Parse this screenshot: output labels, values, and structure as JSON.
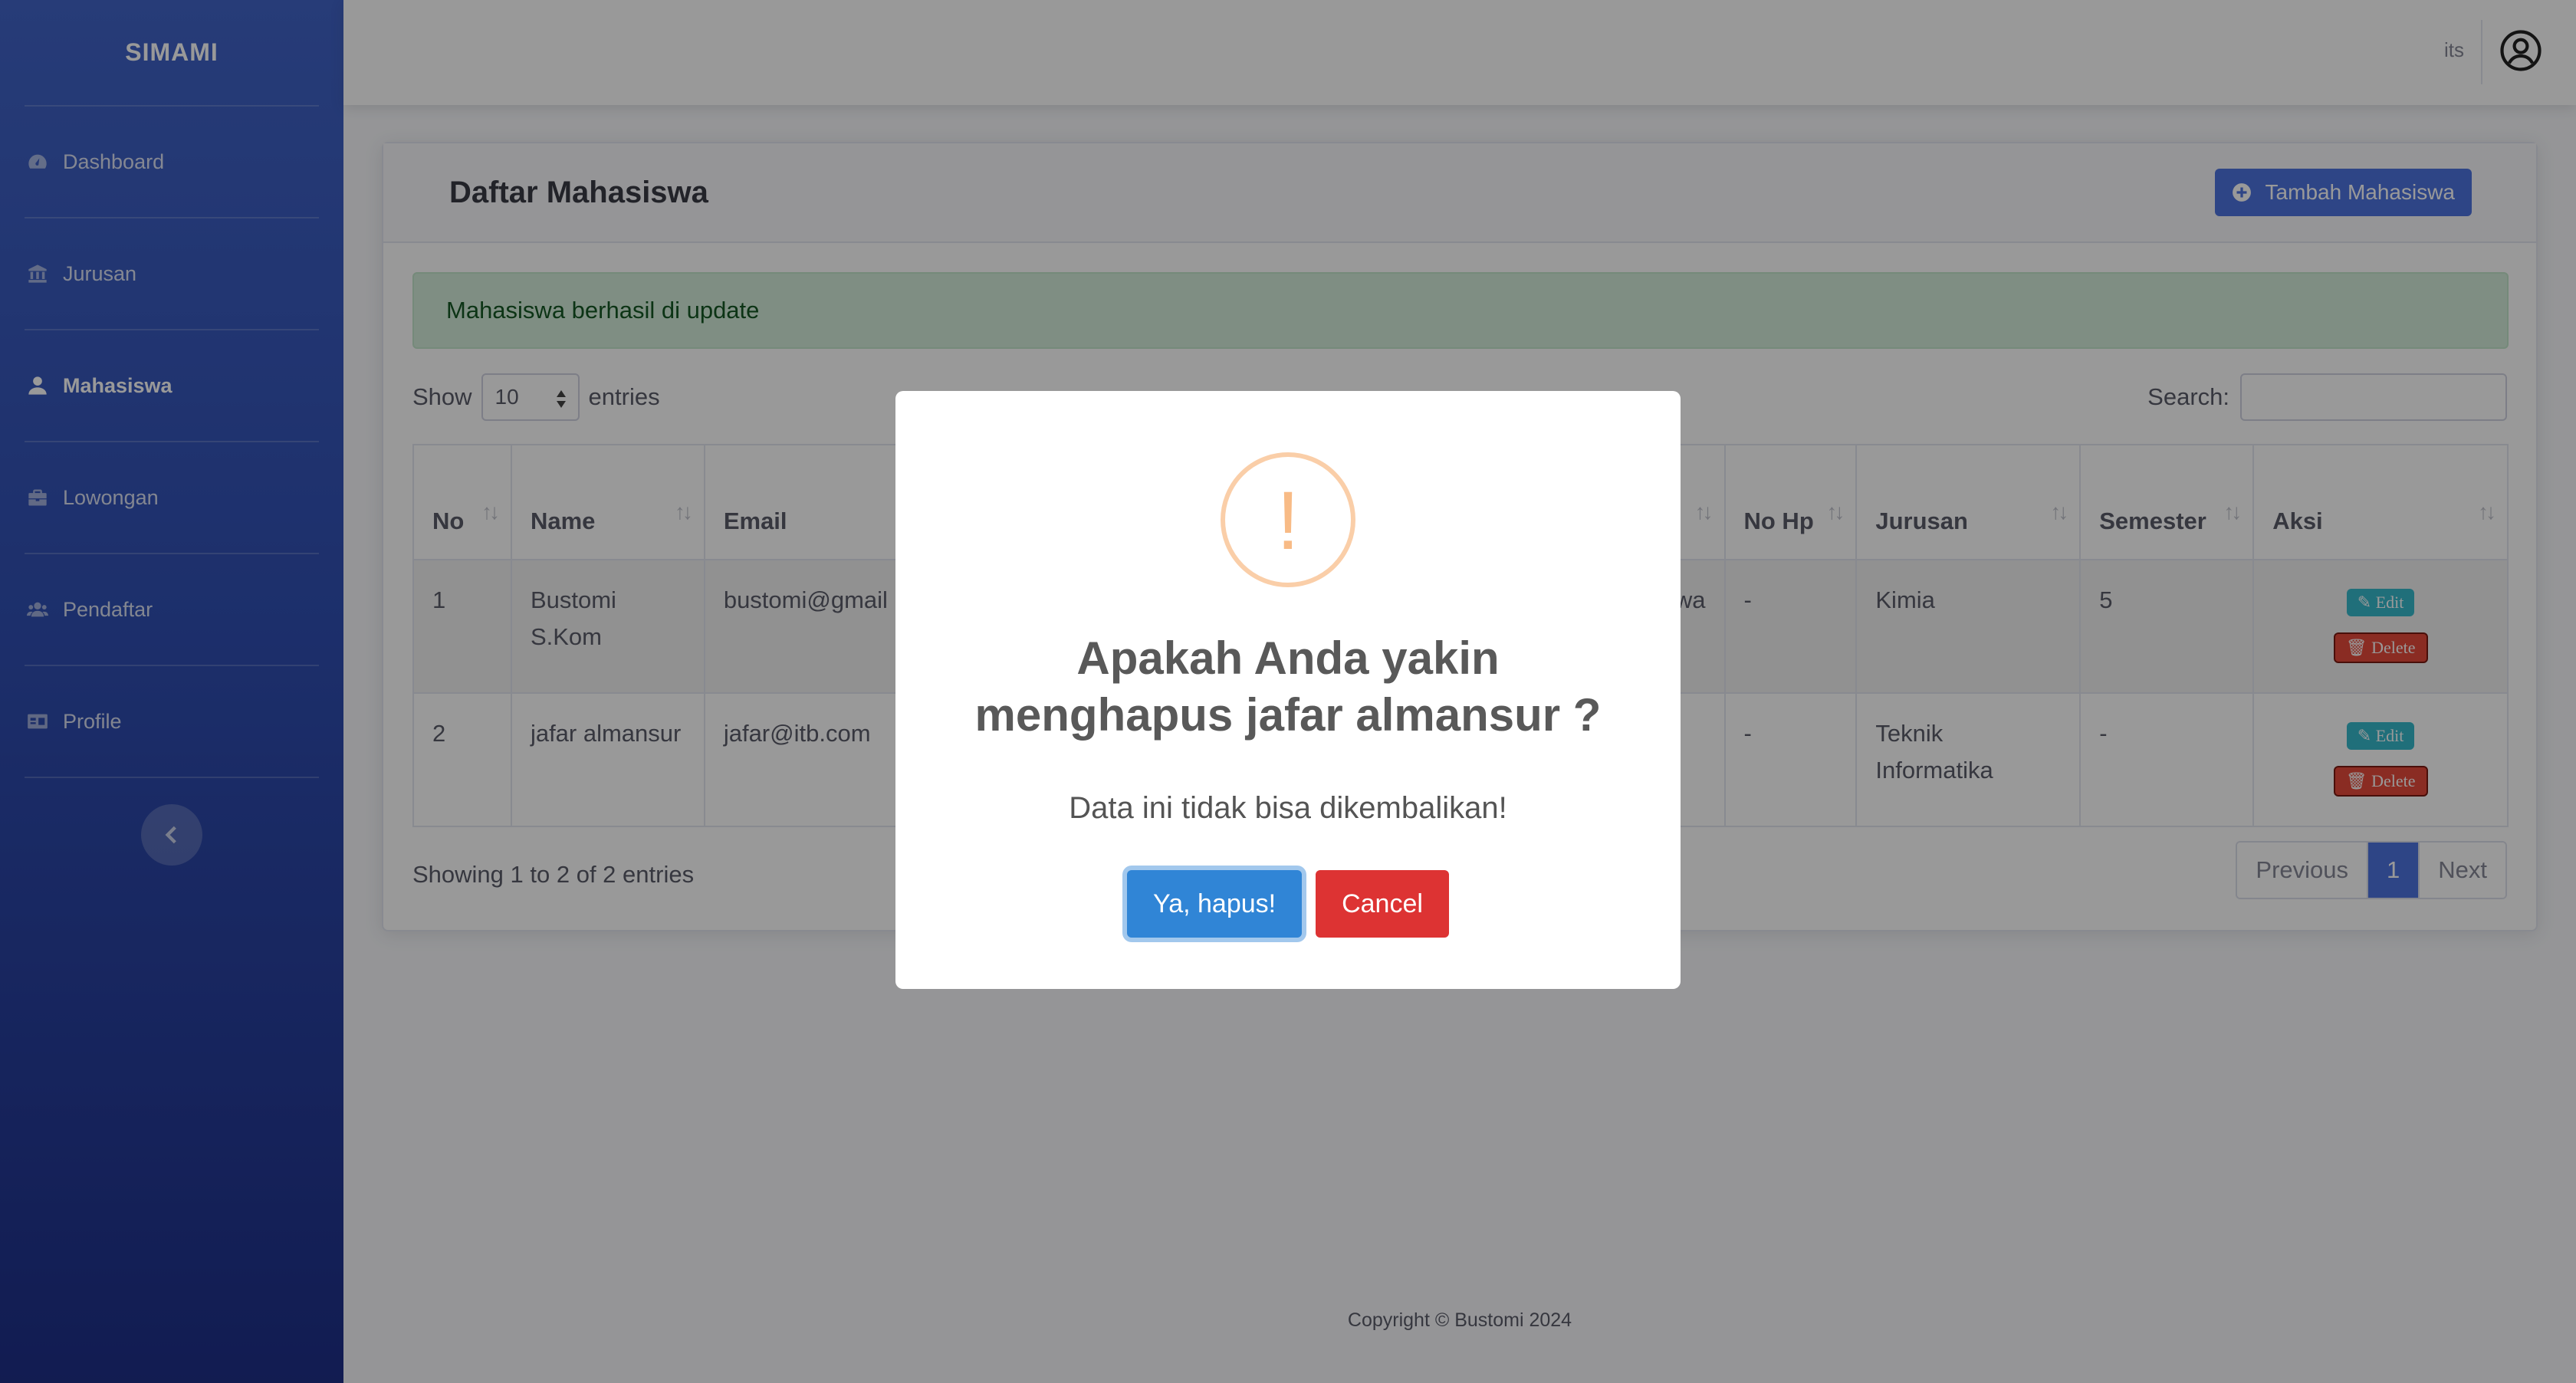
{
  "sidebar": {
    "brand": "SIMAMI",
    "items": [
      {
        "label": "Dashboard",
        "icon": "dashboard-icon"
      },
      {
        "label": "Jurusan",
        "icon": "university-icon"
      },
      {
        "label": "Mahasiswa",
        "icon": "user-icon",
        "active": true
      },
      {
        "label": "Lowongan",
        "icon": "briefcase-icon"
      },
      {
        "label": "Pendaftar",
        "icon": "users-icon"
      },
      {
        "label": "Profile",
        "icon": "id-card-icon"
      }
    ]
  },
  "topbar": {
    "user_name": "its"
  },
  "card": {
    "title": "Daftar Mahasiswa",
    "add_button": "Tambah Mahasiswa"
  },
  "alert": {
    "message": "Mahasiswa berhasil di update"
  },
  "table_controls": {
    "show_label": "Show",
    "entries_label": "entries",
    "length_value": "10",
    "search_label": "Search:"
  },
  "table": {
    "headers": [
      "No",
      "Name",
      "Email",
      "",
      "No Hp",
      "Jurusan",
      "Semester",
      "Aksi"
    ],
    "rows": [
      {
        "no": "1",
        "name": "Bustomi S.Kom",
        "email": "bustomi@gmail",
        "hidden": "awa",
        "no_hp": "-",
        "jurusan": "Kimia",
        "semester": "5"
      },
      {
        "no": "2",
        "name": "jafar almansur",
        "email": "jafar@itb.com",
        "hidden": "",
        "no_hp": "-",
        "jurusan": "Teknik Informatika",
        "semester": "-"
      }
    ],
    "edit_label": "Edit",
    "delete_label": "Delete"
  },
  "table_footer": {
    "info": "Showing 1 to 2 of 2 entries",
    "prev": "Previous",
    "page": "1",
    "next": "Next"
  },
  "footer": {
    "copyright": "Copyright © Bustomi 2024"
  },
  "modal": {
    "icon_glyph": "!",
    "title": "Apakah Anda yakin menghapus jafar almansur ?",
    "text": "Data ini tidak bisa dikembalikan!",
    "confirm": "Ya, hapus!",
    "cancel": "Cancel"
  },
  "colors": {
    "primary": "#4e73df",
    "confirm": "#3085d6",
    "cancel": "#dd3333",
    "warning_ring": "#facea8"
  }
}
